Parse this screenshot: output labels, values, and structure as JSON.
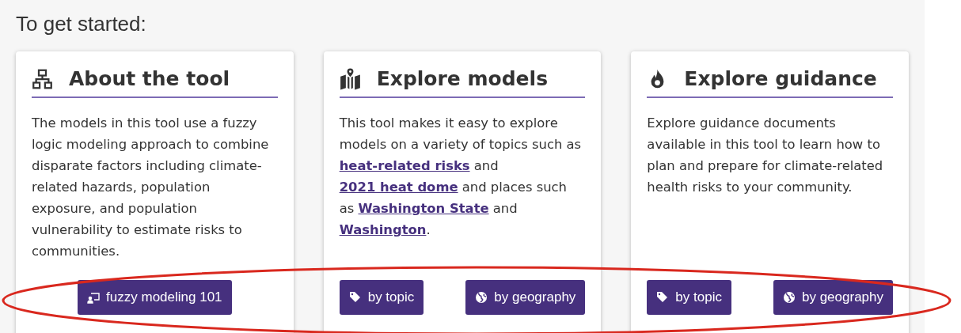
{
  "heading": "To get started:",
  "cards": [
    {
      "kind": "network",
      "title": "About the tool",
      "paragraph": [
        {
          "kind": "text",
          "text": "The models in this tool use a fuzzy logic modeling approach to combine disparate factors including climate-related hazards, population exposure, and population vulnerability to estimate risks to communities."
        }
      ],
      "buttons": [
        {
          "kind": "presenter",
          "label": "fuzzy modeling 101"
        }
      ]
    },
    {
      "kind": "map",
      "title": "Explore models",
      "paragraph": [
        {
          "kind": "text",
          "text": "This tool makes it easy to explore models on a variety of topics such as "
        },
        {
          "kind": "link",
          "text": "heat-related risks"
        },
        {
          "kind": "text",
          "text": " and "
        },
        {
          "kind": "link",
          "text": "2021 heat dome"
        },
        {
          "kind": "text",
          "text": " and places such as "
        },
        {
          "kind": "link",
          "text": "Washington State"
        },
        {
          "kind": "text",
          "text": " and "
        },
        {
          "kind": "link",
          "text": "Washington"
        },
        {
          "kind": "text",
          "text": "."
        }
      ],
      "buttons": [
        {
          "kind": "tag",
          "label": "by topic"
        },
        {
          "kind": "globe",
          "label": "by geography"
        }
      ]
    },
    {
      "kind": "fire",
      "title": "Explore guidance",
      "paragraph": [
        {
          "kind": "text",
          "text": "Explore guidance documents available in this tool to learn how to plan and prepare for climate-related health risks to your community."
        }
      ],
      "buttons": [
        {
          "kind": "tag",
          "label": "by topic"
        },
        {
          "kind": "globe",
          "label": "by geography"
        }
      ]
    }
  ]
}
